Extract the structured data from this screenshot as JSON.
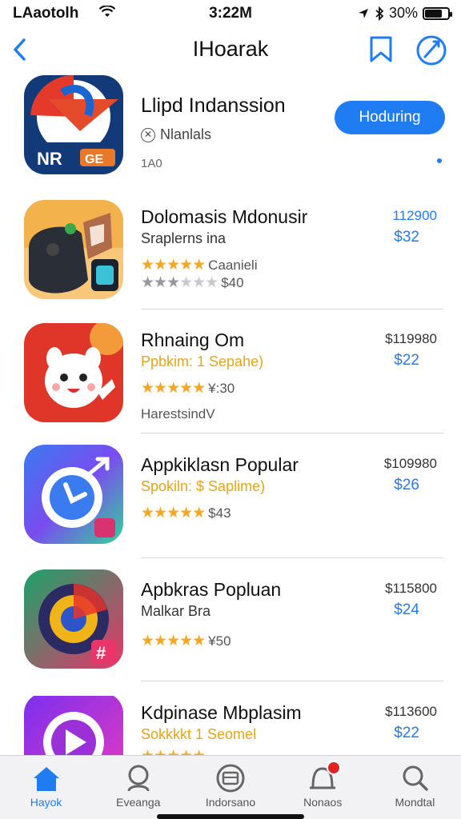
{
  "status_bar": {
    "carrier": "LAaotolh",
    "time": "3:22M",
    "battery": "30%",
    "battery_level": 0.3
  },
  "nav": {
    "title": "IHoarak",
    "icons": [
      "chevron-left-icon",
      "bookmark-icon",
      "compass-icon"
    ]
  },
  "featured": {
    "name": "Llipd Indanssion",
    "subtitle": "Nlanlals",
    "age": "1A0",
    "button": "Hoduring",
    "icon_label": "NR",
    "icon_tag": "GE"
  },
  "apps": [
    {
      "name": "Dolomasis Mdonusir",
      "subtitle": "Sraplerns ina",
      "rating_text": "Caanieli",
      "rating_stars": 5,
      "extra_stars": 3,
      "extra": "$40",
      "price_orig": "112900",
      "price": "$32"
    },
    {
      "name": "Rhnaing Om",
      "subtitle": "Ppbkim: 1  Sepahe)",
      "rating_text": "¥:30",
      "rating_stars": 5,
      "extra": "HarestsindV",
      "price_orig": "$119980",
      "price": "$22"
    },
    {
      "name": "Appkiklasn Popular",
      "subtitle": "Spokiln: $ Saplime)",
      "rating_text": "$43",
      "rating_stars": 5,
      "price_orig": "$109980",
      "price": "$26"
    },
    {
      "name": "Apbkras Popluan",
      "subtitle": "Malkar Bra",
      "rating_text": "¥50",
      "rating_stars": 5,
      "price_orig": "$115800",
      "price": "$24"
    },
    {
      "name": "Kdpinase Mbplasim",
      "subtitle": "Sokkkkt 1 Seomel",
      "rating_stars": 5,
      "price_orig": "$113600",
      "price": "$22"
    }
  ],
  "tabbar": {
    "tabs": [
      {
        "label": "Hayok",
        "icon": "home-icon",
        "active": true
      },
      {
        "label": "Eveanga",
        "icon": "search-person-icon"
      },
      {
        "label": "Indorsano",
        "icon": "apps-icon"
      },
      {
        "label": "Nonaos",
        "icon": "notification-icon"
      },
      {
        "label": "Mondtal",
        "icon": "search-icon"
      }
    ]
  },
  "colors": {
    "accent": "#1f7cf2",
    "star": "#f5a623",
    "badge": "#e02424"
  }
}
